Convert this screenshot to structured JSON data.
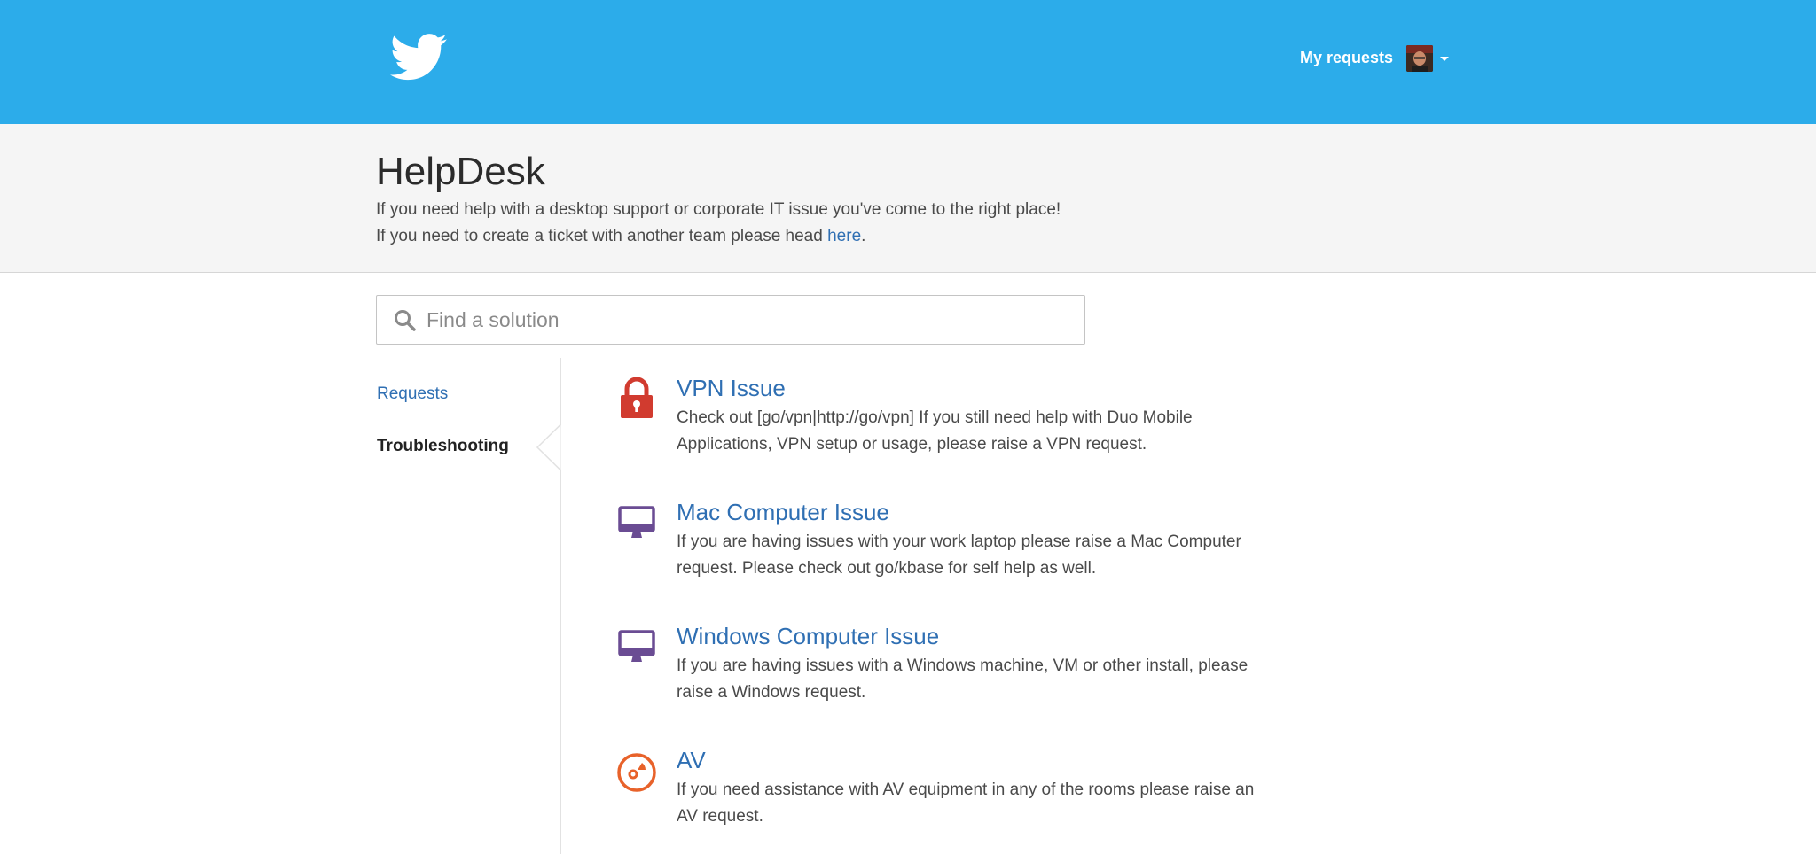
{
  "header": {
    "logo_icon": "twitter-bird-icon",
    "my_requests_label": "My requests",
    "avatar_icon": "user-avatar",
    "menu_caret_icon": "caret-down-icon",
    "brand_color": "#2cacea"
  },
  "hero": {
    "title": "HelpDesk",
    "line1": "If you need help with a desktop support or corporate IT issue you've come to the right place!",
    "line2_prefix": "If you need to create a ticket with another team please head ",
    "line2_link": "here",
    "line2_suffix": "."
  },
  "search": {
    "placeholder": "Find a solution",
    "value": "",
    "icon": "search-icon"
  },
  "sidebar": {
    "items": [
      {
        "label": "Requests",
        "active": false
      },
      {
        "label": "Troubleshooting",
        "active": true
      }
    ]
  },
  "topics": [
    {
      "icon": "lock-icon",
      "icon_color": "#d13b2f",
      "title": "VPN Issue",
      "description": "Check out [go/vpn|http://go/vpn] If you still need help with Duo Mobile Applications, VPN setup or usage, please raise a VPN request."
    },
    {
      "icon": "monitor-icon",
      "icon_color": "#6a4c93",
      "title": "Mac Computer Issue",
      "description": "If you are having issues with your work laptop please raise a Mac Computer request. Please check out go/kbase for self help as well."
    },
    {
      "icon": "monitor-icon",
      "icon_color": "#6a4c93",
      "title": "Windows Computer Issue",
      "description": "If you are having issues with a Windows machine, VM or other install, please raise a Windows request."
    },
    {
      "icon": "av-disc-icon",
      "icon_color": "#e8622a",
      "title": "AV",
      "description": "If you need assistance with AV equipment in any of the rooms please raise an AV request."
    }
  ]
}
